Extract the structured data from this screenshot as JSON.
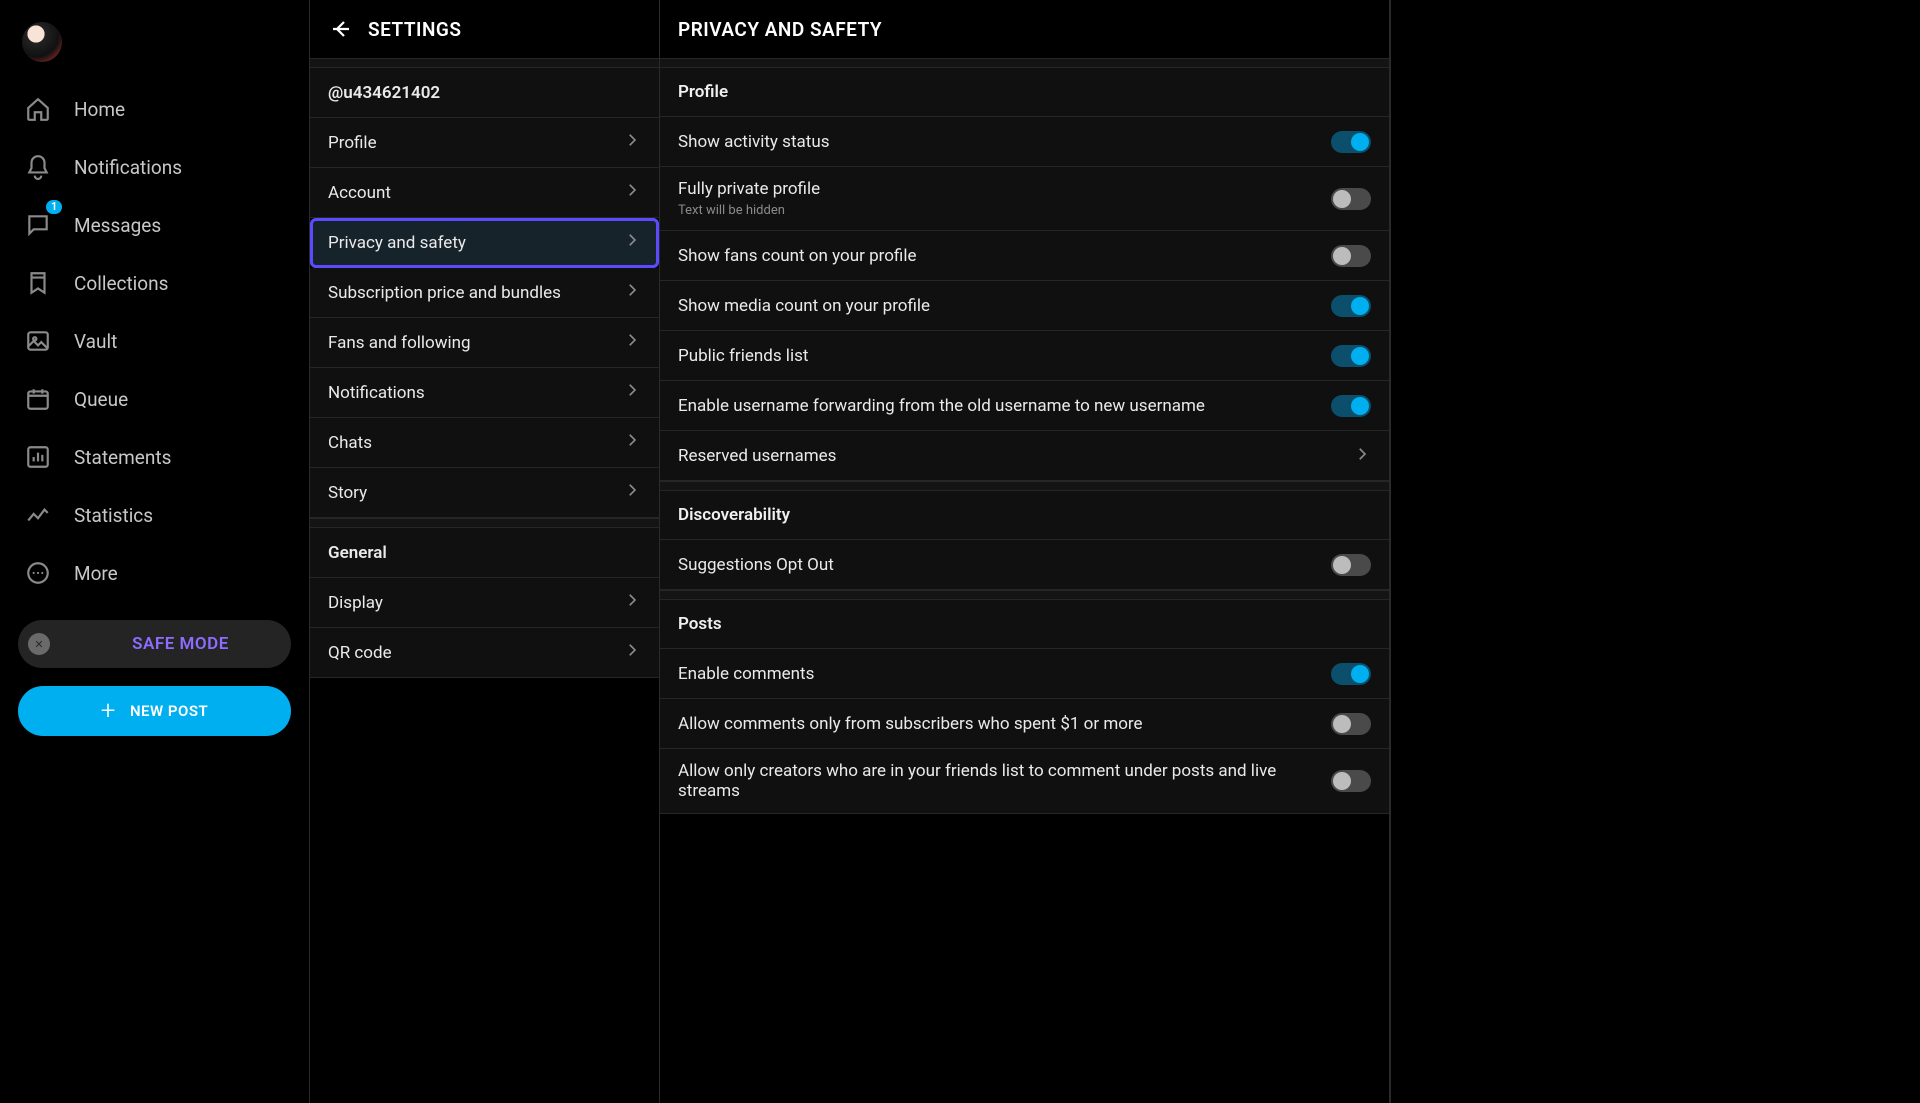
{
  "sidebar": {
    "items": [
      {
        "label": "Home",
        "icon": "home-icon"
      },
      {
        "label": "Notifications",
        "icon": "bell-icon"
      },
      {
        "label": "Messages",
        "icon": "chat-icon",
        "badge": "1"
      },
      {
        "label": "Collections",
        "icon": "bookmark-icon"
      },
      {
        "label": "Vault",
        "icon": "image-icon"
      },
      {
        "label": "Queue",
        "icon": "calendar-icon"
      },
      {
        "label": "Statements",
        "icon": "bar-chart-icon"
      },
      {
        "label": "Statistics",
        "icon": "line-chart-icon"
      },
      {
        "label": "More",
        "icon": "more-icon"
      }
    ],
    "safe_mode_label": "SAFE MODE",
    "new_post_label": "NEW POST"
  },
  "settings": {
    "title": "SETTINGS",
    "username": "@u434621402",
    "items": [
      {
        "label": "Profile"
      },
      {
        "label": "Account"
      },
      {
        "label": "Privacy and safety",
        "selected": true
      },
      {
        "label": "Subscription price and bundles"
      },
      {
        "label": "Fans and following"
      },
      {
        "label": "Notifications"
      },
      {
        "label": "Chats"
      },
      {
        "label": "Story"
      }
    ],
    "general_header": "General",
    "general_items": [
      {
        "label": "Display"
      },
      {
        "label": "QR code"
      }
    ]
  },
  "detail": {
    "title": "PRIVACY AND SAFETY",
    "sections": [
      {
        "header": "Profile",
        "rows": [
          {
            "kind": "toggle",
            "label": "Show activity status",
            "on": true
          },
          {
            "kind": "toggle",
            "label": "Fully private profile",
            "sub": "Text will be hidden",
            "on": false
          },
          {
            "kind": "toggle",
            "label": "Show fans count on your profile",
            "on": false
          },
          {
            "kind": "toggle",
            "label": "Show media count on your profile",
            "on": true
          },
          {
            "kind": "toggle",
            "label": "Public friends list",
            "on": true
          },
          {
            "kind": "toggle",
            "label": "Enable username forwarding from the old username to new username",
            "on": true
          },
          {
            "kind": "link",
            "label": "Reserved usernames"
          }
        ]
      },
      {
        "header": "Discoverability",
        "rows": [
          {
            "kind": "toggle",
            "label": "Suggestions Opt Out",
            "on": false
          }
        ]
      },
      {
        "header": "Posts",
        "rows": [
          {
            "kind": "toggle",
            "label": "Enable comments",
            "on": true
          },
          {
            "kind": "toggle",
            "label": "Allow comments only from subscribers who spent $1 or more",
            "on": false
          },
          {
            "kind": "toggle",
            "label": "Allow only creators who are in your friends list to comment under posts and live streams",
            "on": false
          }
        ]
      }
    ]
  }
}
